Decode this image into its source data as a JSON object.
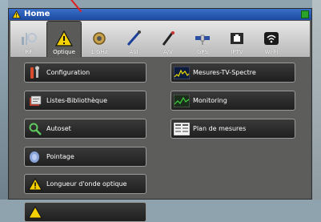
{
  "window": {
    "title": "Home"
  },
  "tabs": [
    {
      "label": "RF",
      "icon": "rf-antenna-icon",
      "active": false
    },
    {
      "label": "Optique",
      "icon": "warning-triangle-icon",
      "active": true
    },
    {
      "label": "1 GHz",
      "icon": "connector-icon",
      "active": false
    },
    {
      "label": "ASI",
      "icon": "asi-cable-icon",
      "active": false
    },
    {
      "label": "A/V",
      "icon": "av-cable-icon",
      "active": false
    },
    {
      "label": "GPS",
      "icon": "satellite-icon",
      "active": false
    },
    {
      "label": "IPTV",
      "icon": "ethernet-icon",
      "active": false
    },
    {
      "label": "Wi-Fi",
      "icon": "wifi-icon",
      "active": false
    }
  ],
  "left_buttons": [
    {
      "label": "Configuration",
      "icon": "tools-icon"
    },
    {
      "label": "Listes-Bibliothèque",
      "icon": "library-icon"
    },
    {
      "label": "Autoset",
      "icon": "autoset-icon"
    },
    {
      "label": "Pointage",
      "icon": "pointing-icon"
    },
    {
      "label": "Longueur d'onde optique",
      "icon": "warning-triangle-icon"
    }
  ],
  "right_buttons": [
    {
      "label": "Mesures-TV-Spectre",
      "icon": "spectrum-icon"
    },
    {
      "label": "Monitoring",
      "icon": "monitoring-icon"
    },
    {
      "label": "Plan de mesures",
      "icon": "measure-plan-icon"
    }
  ],
  "colors": {
    "title_bar": "#1c4aa0",
    "panel": "#5a5a58",
    "button": "#2a2a2a",
    "annotation": "#e02020"
  }
}
